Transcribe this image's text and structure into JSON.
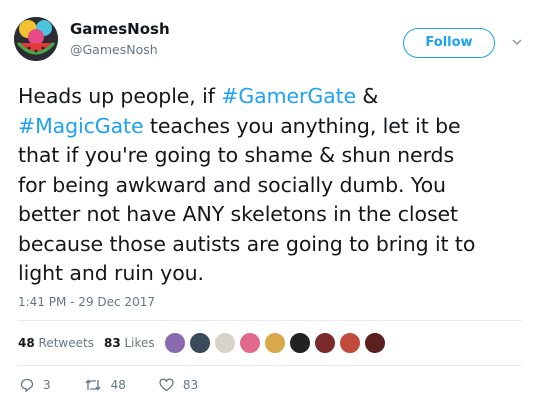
{
  "author": {
    "name": "GamesNosh",
    "handle": "@GamesNosh"
  },
  "header": {
    "follow_label": "Follow",
    "caret_icon": "chevron-down-icon"
  },
  "tweet": {
    "lines": [
      [
        {
          "text": "Heads up people, if "
        },
        {
          "text": "#GamerGate",
          "hashtag": true
        },
        {
          "text": " &"
        }
      ],
      [
        {
          "text": "#MagicGate",
          "hashtag": true
        },
        {
          "text": " teaches you anything, let it be"
        }
      ],
      [
        {
          "text": "that if you're going to shame & shun nerds"
        }
      ],
      [
        {
          "text": "for being awkward and socially dumb. You"
        }
      ],
      [
        {
          "text": "better not have ANY skeletons in the closet"
        }
      ],
      [
        {
          "text": "because those autists are going to bring it to"
        }
      ],
      [
        {
          "text": "light and ruin you."
        }
      ]
    ],
    "timestamp": "1:41 PM - 29 Dec 2017"
  },
  "stats": {
    "retweets_count": "48",
    "retweets_label": "Retweets",
    "likes_count": "83",
    "likes_label": "Likes",
    "liker_colors": [
      "#8a6bb0",
      "#3b4a5a",
      "#d9d2c8",
      "#e06a8c",
      "#d8a84a",
      "#222222",
      "#7a2a2a",
      "#c24a3a",
      "#5a2020"
    ]
  },
  "actions": {
    "reply_count": "3",
    "retweet_count": "48",
    "like_count": "83"
  },
  "colors": {
    "accent": "#1da1f2",
    "muted": "#657786",
    "text": "#14171a"
  }
}
